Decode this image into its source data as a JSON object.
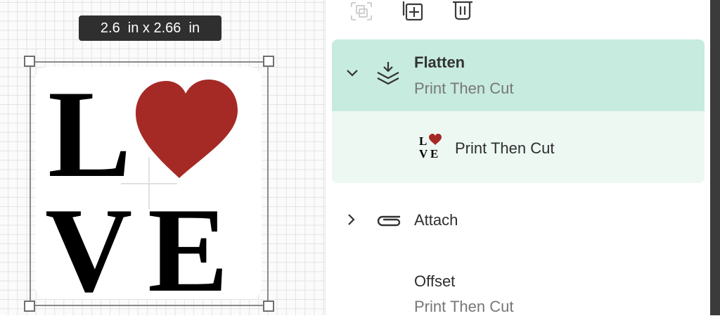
{
  "canvas": {
    "dimensions_label": "2.6  in x 2.66  in",
    "artwork_letters": [
      "L",
      "V",
      "E"
    ],
    "heart_color": "#a52a25"
  },
  "toolbar": {
    "icons": [
      "group-icon",
      "duplicate-icon",
      "delete-icon"
    ]
  },
  "layers": {
    "flatten": {
      "title": "Flatten",
      "subtitle": "Print Then Cut",
      "expanded": true,
      "child": {
        "label": "Print Then Cut"
      }
    },
    "attach": {
      "title": "Attach",
      "expanded": false
    },
    "offset": {
      "title": "Offset",
      "subtitle": "Print Then Cut"
    }
  },
  "colors": {
    "selected_header": "#c7ebde",
    "selected_body": "#edf8f3",
    "heart": "#a52a25"
  }
}
